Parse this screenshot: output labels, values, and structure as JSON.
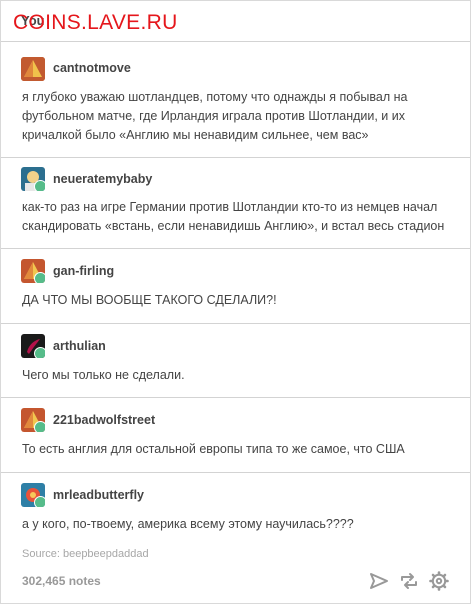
{
  "header": {
    "label": "You"
  },
  "watermark": "COINS.LAVE.RU",
  "posts": [
    {
      "username": "cantnotmove",
      "text": "я глубоко уважаю шотландцев, потому что однажды я побывал на футбольном матче, где Ирландия играла против Шотландии, и их кричалкой было «Англию мы ненавидим сильнее, чем вас»"
    },
    {
      "username": "neueratemybaby",
      "text": "как-то раз на игре Германии против Шотландии кто-то из немцев начал скандировать «встань, если ненавидишь Англию», и встал весь стадион"
    },
    {
      "username": "gan-firling",
      "text": "ДА ЧТО МЫ ВООБЩЕ ТАКОГО СДЕЛАЛИ?!"
    },
    {
      "username": "arthulian",
      "text": "Чего мы только не сделали."
    },
    {
      "username": "221badwolfstreet",
      "text": "То есть англия для остальной европы типа то же самое, что США"
    },
    {
      "username": "mrleadbutterfly",
      "text": "а у кого, по-твоему, америка всему этому научилась????"
    }
  ],
  "footer": {
    "source": "Source: beepbeepdaddad",
    "notes": "302,465 notes"
  },
  "colors": {
    "watermark": "#e5161b",
    "badge": "#56bc8a",
    "divider": "#d3d3d3"
  },
  "icons": [
    "send-icon",
    "reblog-icon",
    "settings-icon"
  ]
}
